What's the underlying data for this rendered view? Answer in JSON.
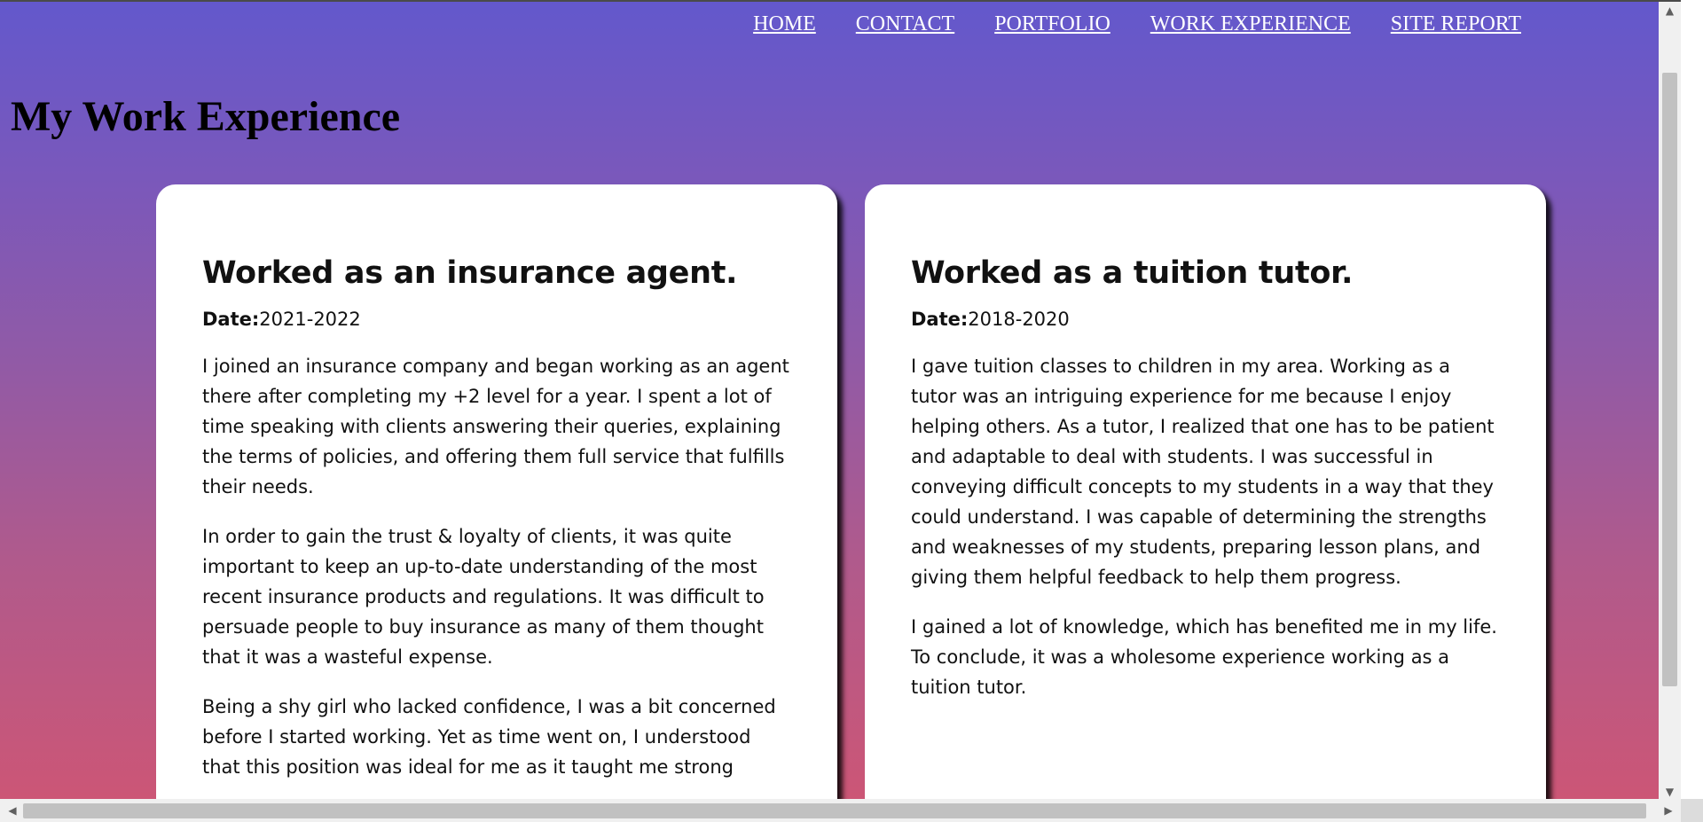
{
  "nav": {
    "items": [
      "HOME",
      "CONTACT",
      "PORTFOLIO",
      "WORK EXPERIENCE",
      "SITE REPORT"
    ]
  },
  "page": {
    "title": "My Work Experience"
  },
  "cards": [
    {
      "title": "Worked as an insurance agent.",
      "date_label": "Date:",
      "date_value": "2021-2022",
      "paragraphs": [
        "I joined an insurance company and began working as an agent there after completing my +2 level for a year. I spent a lot of time speaking with clients answering their queries, explaining the terms of policies, and offering them full service that fulfills their needs.",
        "In order to gain the trust & loyalty of clients, it was quite important to keep an up-to-date understanding of the most recent insurance products and regulations. It was difficult to persuade people to buy insurance as many of them thought that it was a wasteful expense.",
        "Being a shy girl who lacked confidence, I was a bit concerned before I started working. Yet as time went on, I understood that this position was ideal for me as it taught me strong"
      ]
    },
    {
      "title": "Worked as a tuition tutor.",
      "date_label": "Date:",
      "date_value": "2018-2020",
      "paragraphs": [
        "I gave tuition classes to children in my area. Working as a tutor was an intriguing experience for me because I enjoy helping others. As a tutor, I realized that one has to be patient and adaptable to deal with students. I was successful in conveying difficult concepts to my students in a way that they could understand. I was capable of determining the strengths and weaknesses of my students, preparing lesson plans, and giving them helpful feedback to help them progress.",
        "I gained a lot of knowledge, which has benefited me in my life. To conclude, it was a wholesome experience working as a tuition tutor."
      ]
    }
  ],
  "scrollbars": {
    "up_icon": "chevron-up-icon",
    "down_icon": "chevron-down-icon",
    "left_icon": "chevron-left-icon",
    "right_icon": "chevron-right-icon"
  },
  "colors": {
    "gradient_top": "#6358cc",
    "gradient_bottom": "#cc5676",
    "card": "#ffffff"
  }
}
